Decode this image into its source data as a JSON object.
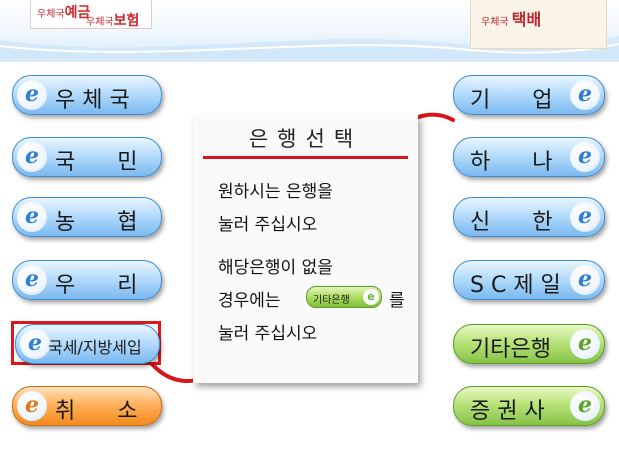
{
  "header": {
    "left_logo_part1_prefix": "우체국",
    "left_logo_part1_word": "예금",
    "left_logo_part2_prefix": "우체국",
    "left_logo_part2_word": "보험",
    "right_logo_prefix": "우체국",
    "right_logo_word": "택배"
  },
  "panel": {
    "title": "은행선택",
    "line1": "원하시는 은행을",
    "line2": "눌러 주십시오",
    "line3": "해당은행이 없을",
    "line4_pre": "경우에는",
    "line4_post": "를",
    "line5": "눌러 주십시오",
    "inline_button": "기타은행",
    "inline_button_icon": "e-icon"
  },
  "left_buttons": [
    {
      "label": "우 체 국",
      "color": "blue"
    },
    {
      "label": "국      민",
      "color": "blue"
    },
    {
      "label": "농      협",
      "color": "blue"
    },
    {
      "label": "우      리",
      "color": "blue"
    },
    {
      "label": "국세/지방세입",
      "color": "blue"
    },
    {
      "label": "취      소",
      "color": "orange"
    }
  ],
  "right_buttons": [
    {
      "label": "기      업",
      "color": "blue"
    },
    {
      "label": "하      나",
      "color": "blue"
    },
    {
      "label": "신      한",
      "color": "blue"
    },
    {
      "label": "S C 제 일",
      "color": "blue"
    },
    {
      "label": "기타은행",
      "color": "green"
    },
    {
      "label": "증 권 사",
      "color": "green"
    }
  ],
  "button_icon_glyph": "e",
  "colors": {
    "accent_red": "#d8151b",
    "button_blue": "#7ab9f0",
    "button_green": "#86c346",
    "button_orange": "#f28a1e"
  }
}
